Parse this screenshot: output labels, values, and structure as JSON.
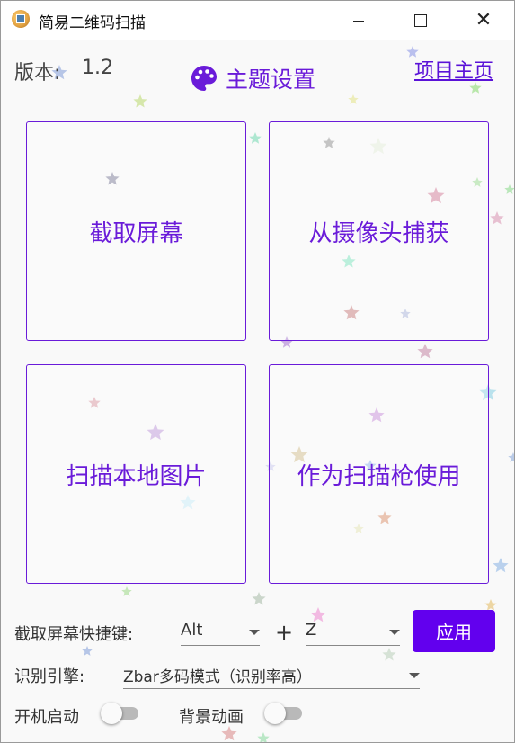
{
  "window": {
    "title": "简易二维码扫描",
    "icons": {
      "app": "qr-app-icon",
      "minimize": "minimize-icon",
      "maximize": "maximize-icon",
      "close": "close-icon",
      "close_glyph": "✕"
    }
  },
  "header": {
    "version_label": "版本:",
    "version_value": "1.2",
    "theme_label": "主题设置",
    "theme_icon": "palette-icon",
    "home_link": "项目主页"
  },
  "actions": [
    {
      "label": "截取屏幕"
    },
    {
      "label": "从摄像头捕获"
    },
    {
      "label": "扫描本地图片"
    },
    {
      "label": "作为扫描枪使用"
    }
  ],
  "shortcut": {
    "label": "截取屏幕快捷键:",
    "modifier": "Alt",
    "plus": "+",
    "key": "Z",
    "apply": "应用"
  },
  "engine": {
    "label": "识别引擎:",
    "value": "Zbar多码模式（识别率高）"
  },
  "toggles": {
    "boot_label": "开机启动",
    "boot_on": false,
    "anim_label": "背景动画",
    "anim_on": false
  },
  "colors": {
    "accent": "#6a1bd9",
    "apply_button": "#6200ee",
    "toggle_track": "#b9b9b9"
  }
}
